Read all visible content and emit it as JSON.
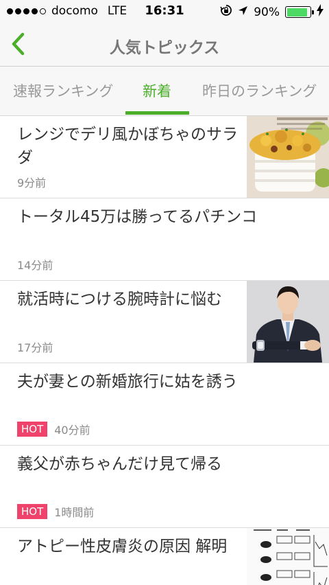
{
  "status_bar": {
    "carrier": "docomo",
    "network": "LTE",
    "time": "16:31",
    "battery_percent": "90%",
    "battery_level": 0.9
  },
  "nav": {
    "title": "人気トピックス",
    "back_icon": "chevron-left-icon"
  },
  "tabs": [
    {
      "label": "速報ランキング",
      "active": false
    },
    {
      "label": "新着",
      "active": true
    },
    {
      "label": "昨日のランキング",
      "active": false
    }
  ],
  "articles": [
    {
      "title": "レンジでデリ風かぼちゃのサラダ",
      "time": "9分前",
      "hot": false,
      "thumbnail": "pumpkin-salad-image"
    },
    {
      "title": "トータル45万は勝ってるパチンコ",
      "time": "14分前",
      "hot": false
    },
    {
      "title": "就活時につける腕時計に悩む",
      "time": "17分前",
      "hot": false,
      "thumbnail": "businessman-watch-image"
    },
    {
      "title": "夫が妻との新婚旅行に姑を誘う",
      "time": "40分前",
      "hot": true,
      "hot_label": "HOT"
    },
    {
      "title": "義父が赤ちゃんだけ見て帰る",
      "time": "1時間前",
      "hot": true,
      "hot_label": "HOT"
    },
    {
      "title": "アトピー性皮膚炎の原因 解明",
      "hot": false,
      "thumbnail": "research-chart-image"
    }
  ],
  "colors": {
    "accent": "#4caf2a",
    "hot": "#f0436b",
    "bar_bg": "#f7f7f7",
    "battery": "#4cd964"
  }
}
